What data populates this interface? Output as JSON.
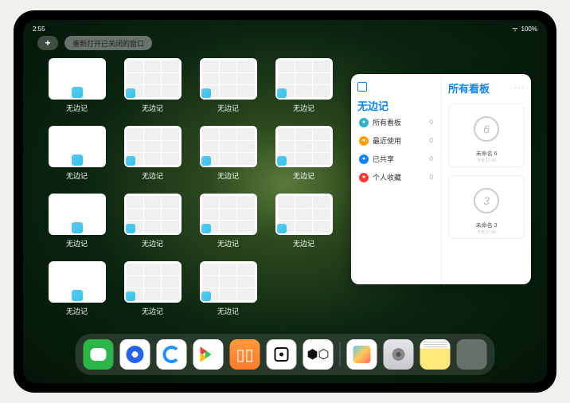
{
  "status": {
    "time": "2:55",
    "wifi": "●",
    "battery": "100%"
  },
  "topbar": {
    "plus": "+",
    "reopen_label": "重新打开已关闭的窗口"
  },
  "thumbs": {
    "label": "无边记",
    "items": [
      {
        "variant": "blank"
      },
      {
        "variant": "grid"
      },
      {
        "variant": "grid"
      },
      {
        "variant": "grid"
      },
      {
        "variant": "blank"
      },
      {
        "variant": "grid"
      },
      {
        "variant": "grid"
      },
      {
        "variant": "grid"
      },
      {
        "variant": "blank"
      },
      {
        "variant": "grid"
      },
      {
        "variant": "grid"
      },
      {
        "variant": "grid"
      },
      {
        "variant": "blank"
      },
      {
        "variant": "grid"
      },
      {
        "variant": "grid"
      }
    ]
  },
  "popup": {
    "left_title": "无边记",
    "items": [
      {
        "icon_color": "#30b0c7",
        "label": "所有看板",
        "count": "0"
      },
      {
        "icon_color": "#ff9f0a",
        "label": "最近使用",
        "count": "0"
      },
      {
        "icon_color": "#0a84ff",
        "label": "已共享",
        "count": "0"
      },
      {
        "icon_color": "#ff3b30",
        "label": "个人收藏",
        "count": "0"
      }
    ],
    "right_title": "所有看板",
    "dots": "···",
    "boards": [
      {
        "num": "6",
        "name": "未命名 6",
        "time": "今天 17:20"
      },
      {
        "num": "3",
        "name": "未命名 3",
        "time": "今天 17:20"
      }
    ]
  },
  "dock": {
    "apps": [
      {
        "name": "wechat"
      },
      {
        "name": "quark"
      },
      {
        "name": "qqbrowser"
      },
      {
        "name": "play"
      },
      {
        "name": "books"
      },
      {
        "name": "dice"
      },
      {
        "name": "nodes"
      }
    ],
    "recents": [
      {
        "name": "freeform"
      },
      {
        "name": "settings"
      },
      {
        "name": "notes"
      },
      {
        "name": "appfolder"
      }
    ]
  }
}
